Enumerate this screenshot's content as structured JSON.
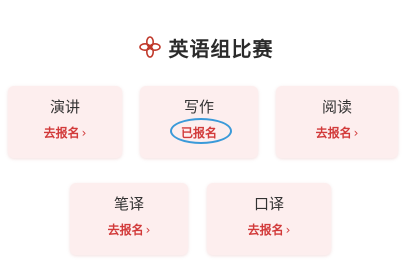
{
  "header": {
    "icon": "flower-icon",
    "title": "英语组比赛"
  },
  "colors": {
    "card_bg": "#fdeeee",
    "accent_red": "#d23a3a",
    "highlight_blue": "#3a9ad9"
  },
  "competitions": [
    {
      "title": "演讲",
      "action": "去报名",
      "chevron": "›"
    },
    {
      "title": "写作",
      "action": "已报名",
      "chevron": ""
    },
    {
      "title": "阅读",
      "action": "去报名",
      "chevron": "›"
    },
    {
      "title": "笔译",
      "action": "去报名",
      "chevron": "›"
    },
    {
      "title": "口译",
      "action": "去报名",
      "chevron": "›"
    }
  ]
}
